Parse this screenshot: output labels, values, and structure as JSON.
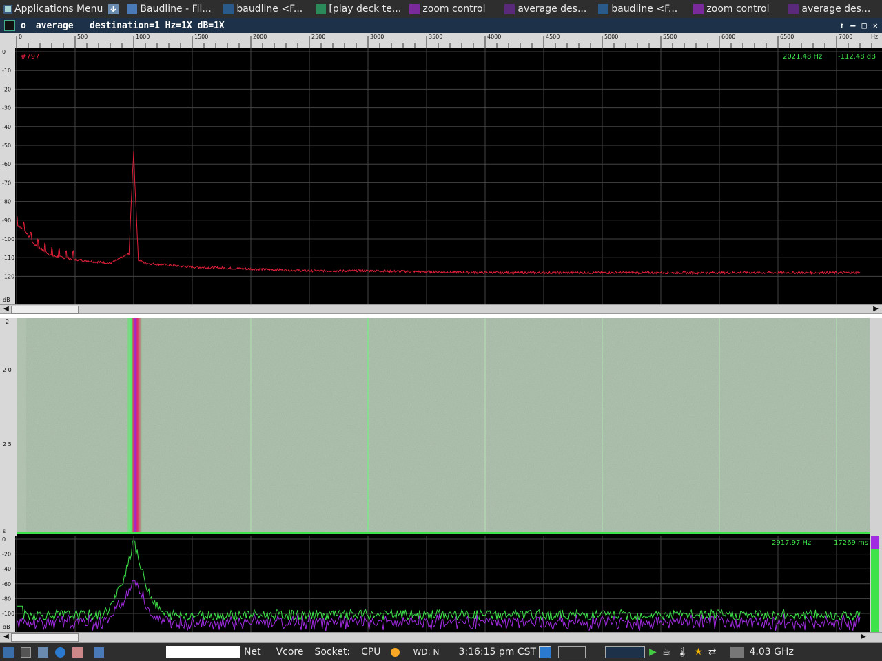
{
  "taskbar": {
    "apps_menu": "Applications Menu",
    "tasks": [
      {
        "label": "Baudline - Fil...",
        "icon": "folder-icon"
      },
      {
        "label": "baudline  <F...",
        "icon": "baudline-icon"
      },
      {
        "label": "[play deck  te...",
        "icon": "play-icon"
      },
      {
        "label": "zoom control",
        "icon": "zoom-icon"
      },
      {
        "label": "average   des...",
        "icon": "average-icon"
      },
      {
        "label": "baudline  <F...",
        "icon": "baudline-icon"
      },
      {
        "label": "zoom control",
        "icon": "zoom-icon"
      },
      {
        "label": "average   des...",
        "icon": "average-icon"
      }
    ]
  },
  "window": {
    "left_marker": "o",
    "title": "average   destination=1 Hz=1X dB=1X",
    "controls": [
      "↑",
      "–",
      "□",
      "✕"
    ]
  },
  "ruler": {
    "ticks": [
      "0",
      "500",
      "1000",
      "1500",
      "2000",
      "2500",
      "3000",
      "3500",
      "4000",
      "4500",
      "5000",
      "5500",
      "6000",
      "6500",
      "7000"
    ],
    "unit": "Hz"
  },
  "spectrum": {
    "slice_label": "#797",
    "cursor_freq": "2021.48 Hz",
    "cursor_db": "-112.48 dB",
    "y_ticks": [
      "0",
      "-10",
      "-20",
      "-30",
      "-40",
      "-50",
      "-60",
      "-70",
      "-80",
      "-90",
      "-100",
      "-110",
      "-120"
    ],
    "y_unit": "dB",
    "line_color": "#e0203a"
  },
  "waterfall": {
    "time_ticks": [
      "2",
      "2\n0",
      "2\n5",
      "s"
    ]
  },
  "bottom_spectrum": {
    "cursor_freq": "2917.97 Hz",
    "cursor_time": "17269 ms",
    "y_ticks": [
      "0",
      "-20",
      "-40",
      "-60",
      "-80",
      "-100"
    ],
    "y_unit": "dB",
    "green_color": "#3ee34a",
    "purple_color": "#a02be0"
  },
  "statusbar": {
    "net": "Net",
    "vcore": "Vcore",
    "socket": "Socket:",
    "cpu": "CPU",
    "wd": "WD: N",
    "clock": "3:16:15 pm CST",
    "cpu_freq": "4.03 GHz"
  },
  "chart_data": {
    "type": "line",
    "x_unit": "Hz",
    "xlim": [
      0,
      7200
    ],
    "ylim": [
      -125,
      0
    ],
    "series": [
      {
        "values": [
          [
            0,
            -92
          ],
          [
            60,
            -95
          ],
          [
            100,
            -98
          ],
          [
            150,
            -103
          ],
          [
            300,
            -109
          ],
          [
            500,
            -111
          ],
          [
            800,
            -113
          ],
          [
            960,
            -108
          ],
          [
            990,
            -65
          ],
          [
            1000,
            -53
          ],
          [
            1010,
            -70
          ],
          [
            1040,
            -111
          ],
          [
            1100,
            -113
          ],
          [
            1500,
            -115
          ],
          [
            2000,
            -116
          ],
          [
            2500,
            -117
          ],
          [
            3000,
            -117
          ],
          [
            4000,
            -118
          ],
          [
            5000,
            -118
          ],
          [
            6000,
            -118
          ],
          [
            7200,
            -118
          ]
        ]
      }
    ]
  }
}
